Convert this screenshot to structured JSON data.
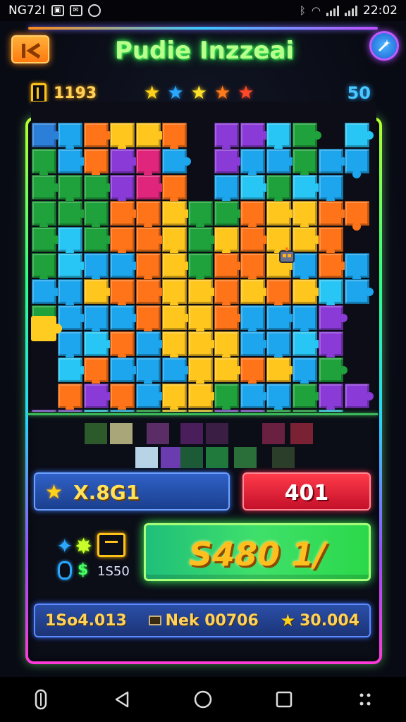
{
  "status_bar": {
    "left_text": "NG72I",
    "time": "22:02"
  },
  "header": {
    "title": "Pudie Inzzeai",
    "coins": "1193",
    "level": "50",
    "star_colors": [
      "#ffd21a",
      "#2aa8ff",
      "#ffe02a",
      "#ff7a1a",
      "#ff4a2a"
    ]
  },
  "board": {
    "grid": [
      "DBOYYO_PPLG_L",
      "GBOPMB_PBBGBB",
      "GGGPMO_BLGLB",
      "GGGOOYGGOYYOO",
      "GLGOOYGYOYYO_",
      "GLBBOYGOOYBOB",
      "BBYOOYYOYOYLB",
      "GBBBOYYOBBBP_",
      "_BLOBYYYBBLP_",
      "_LOBBBYYOYBG_",
      "_OPOBYYGBBGPP",
      "PPLBGYYPPGGL_",
      "PPGLGMYGP_GP_"
    ],
    "palette": {
      "B": "#1da6ee",
      "L": "#28c6f5",
      "O": "#ff7418",
      "Y": "#ffc61e",
      "G": "#1fa23c",
      "P": "#8a3ad6",
      "M": "#e0257c",
      "D": "#2c7fd8"
    }
  },
  "tray": {
    "colors": [
      "#2d5a2a",
      "#a9a77a",
      "#5a2d66",
      "#4a1e5a",
      "#3a1e44",
      "#6a2040",
      "#7a2234",
      "#b7d3e6",
      "#6b3bb0",
      "#1d5a36",
      "#1f7a3c",
      "#2a6e3a",
      "#2a3e2a"
    ]
  },
  "scores": {
    "score": "X.8G1",
    "moves": "401",
    "booster_count": "1S50",
    "big_button": "S480 1/"
  },
  "footer": {
    "left": "1So4.013",
    "middle": "Nek 00706",
    "right": "30.004"
  }
}
